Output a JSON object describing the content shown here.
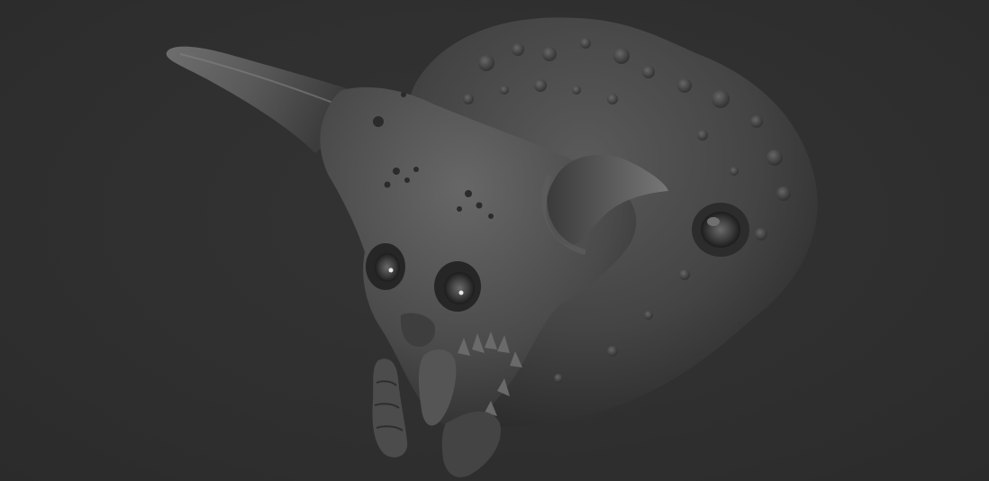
{
  "scene": {
    "subject": "sculpted-creature-head",
    "colors": {
      "background": "#303030",
      "clay_dark": "#2a2a2a",
      "clay_mid": "#4a4a4a",
      "clay_light": "#7a7a7a",
      "eye_highlight": "#e8e8e8"
    }
  }
}
